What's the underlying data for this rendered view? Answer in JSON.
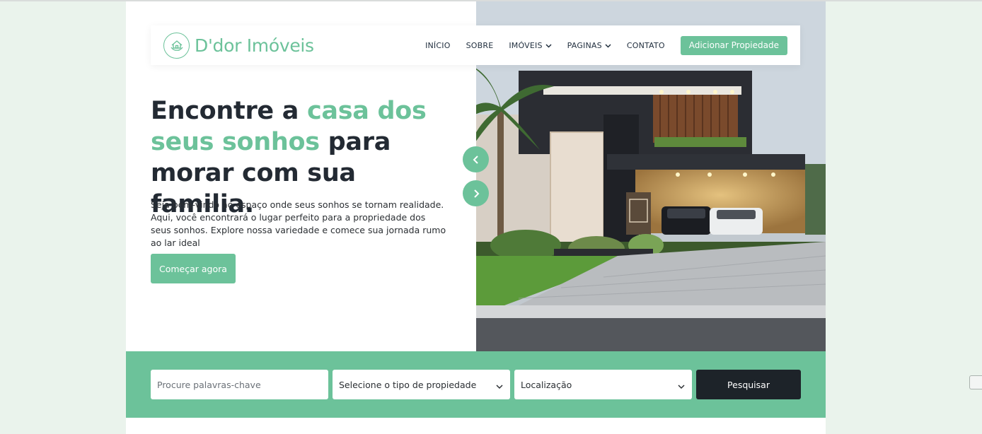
{
  "brand": {
    "name": "D'dor Imóveis",
    "logo_icon": "house-hands-icon",
    "accent_color": "#6cc29a"
  },
  "nav": {
    "items": [
      {
        "label": "INÍCIO",
        "dropdown": false
      },
      {
        "label": "SOBRE",
        "dropdown": false
      },
      {
        "label": "IMÓVEIS",
        "dropdown": true
      },
      {
        "label": "PAGINAS",
        "dropdown": true
      },
      {
        "label": "CONTATO",
        "dropdown": false
      }
    ],
    "cta_label": "Adicionar Propiedade"
  },
  "hero": {
    "title_part1": "Encontre a ",
    "title_accent": "casa dos seus sonhos",
    "title_part2": " para morar com sua familia.",
    "description": "Seja bem-vindo ao espaço onde seus sonhos se tornam realidade. Aqui, você encontrará o lugar perfeito para a propriedade dos seus sonhos. Explore nossa variedade e comece sua jornada rumo ao lar ideal",
    "cta_label": "Começar agora",
    "prev_icon": "chevron-left-icon",
    "next_icon": "chevron-right-icon"
  },
  "search": {
    "keyword_placeholder": "Procure palavras-chave",
    "type_select": "Selecione o tipo de propiedade",
    "location_select": "Localização",
    "button_label": "Pesquisar",
    "dark_color": "#1d2329"
  }
}
